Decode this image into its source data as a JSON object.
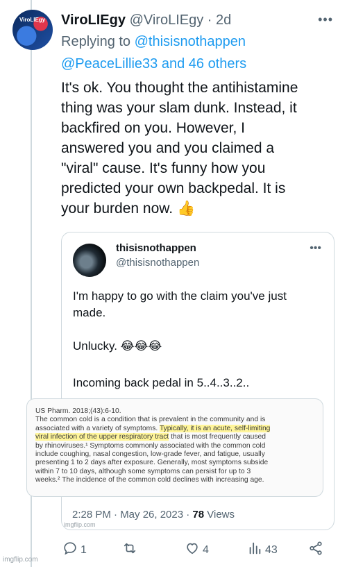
{
  "tweet": {
    "avatar_text": "ViroLIEgy",
    "name": "ViroLIEgy",
    "handle": "@ViroLIEgy",
    "separator": "·",
    "time": "2d",
    "replying_prefix": "Replying to",
    "reply_to_1": "@thisisnothappen",
    "reply_to_2": "@PeaceLillie33 and 46 others",
    "text_lines": [
      "It's ok. You thought the antihistamine",
      "thing was your slam dunk. Instead, it",
      "backfired on you. However, I",
      "answered you and you claimed a",
      "\"viral\" cause. It's funny how you",
      "predicted your own backpedal. It is",
      "your burden now. 👍"
    ]
  },
  "quote": {
    "name": "thisisnothappen",
    "handle": "@thisisnothappen",
    "line1": "I'm happy to go with the claim you've just",
    "line2": "made.",
    "line3": "Unlucky. 😂😂😂",
    "line4": "Incoming back pedal in 5..4..3..2..",
    "excerpt": {
      "citation": "US Pharm. 2018;(43):6-10.",
      "p1": "The common cold is a condition that is prevalent in the community and is",
      "p2_pre": "associated with a variety of symptoms. ",
      "p2_hl": "Typically, it is an acute, self-limiting",
      "p3_hl": "viral infection of the upper respiratory tract",
      "p3_post": " that is most frequently caused",
      "p4": "by rhinoviruses.¹ Symptoms commonly associated with the common cold",
      "p5": "include coughing, nasal congestion, low-grade fever, and fatigue, usually",
      "p6": "presenting 1 to 2 days after exposure. Generally, most symptoms subside",
      "p7": "within 7 to 10 days, although some symptoms can persist for up to 3",
      "p8": "weeks.² The incidence of the common cold declines with increasing age."
    },
    "timestamp": "2:28 PM · May 26, 2023 · ",
    "views_count": "78",
    "views_label": " Views"
  },
  "actions": {
    "replies": "1",
    "retweets": "",
    "likes": "4",
    "views": "43"
  },
  "watermark": "imgflip.com",
  "watermark_inner": "imgflip.com"
}
